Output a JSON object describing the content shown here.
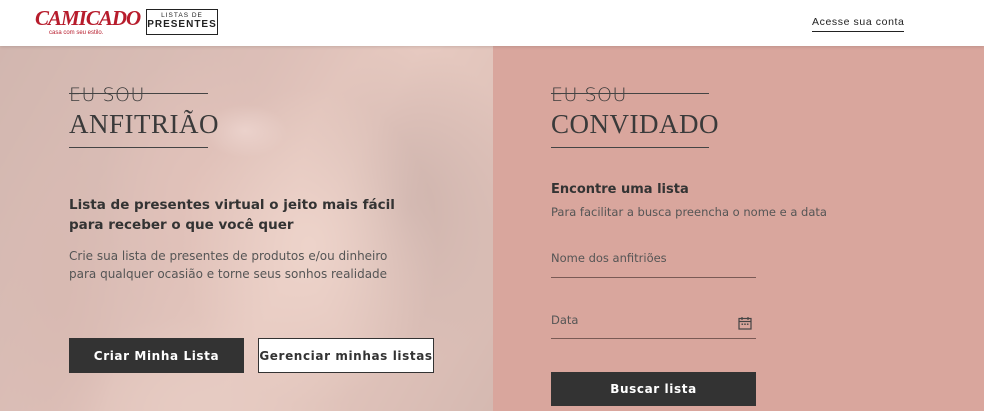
{
  "header": {
    "logo_text": "CAMICADO",
    "logo_tagline": "casa com seu estilo.",
    "listas_small": "LISTAS DE",
    "listas_big": "PRESENTES",
    "account_link": "Acesse sua conta"
  },
  "host": {
    "eu_sou": "EU SOU",
    "role": "ANFITRIÃO",
    "lead": "Lista de presentes virtual o jeito mais fácil para receber o que você quer",
    "description": "Crie sua lista de presentes de produtos e/ou dinheiro para qualquer ocasião e torne seus sonhos realidade",
    "create_button": "Criar Minha Lista",
    "manage_button": "Gerenciar minhas listas"
  },
  "guest": {
    "eu_sou": "EU SOU",
    "role": "CONVIDADO",
    "find_title": "Encontre uma lista",
    "find_subtitle": "Para facilitar a busca preencha o nome e a data",
    "hosts_placeholder": "Nome dos anfitriões",
    "date_placeholder": "Data",
    "search_button": "Buscar lista"
  },
  "icons": {
    "date_field_icon": "calendar-icon"
  },
  "colors": {
    "brand_red": "#b71c2c",
    "guest_panel": "#d9a69d",
    "host_overlay": "#f0d6d0",
    "dark_button": "#333333"
  }
}
